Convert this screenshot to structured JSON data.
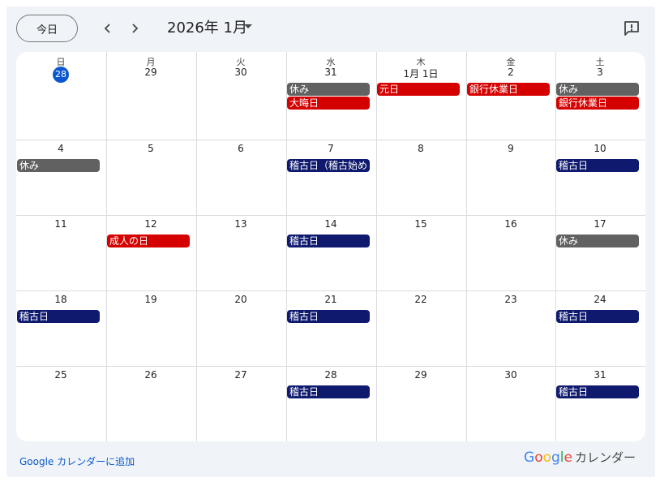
{
  "toolbar": {
    "today_label": "今日",
    "month_title": "2026年 1月",
    "prev_icon": "chevron-left-icon",
    "next_icon": "chevron-right-icon",
    "feedback_icon": "feedback-icon"
  },
  "weekdays": [
    "日",
    "月",
    "火",
    "水",
    "木",
    "金",
    "土"
  ],
  "weeks": [
    [
      {
        "date": "28",
        "today": true,
        "events": []
      },
      {
        "date": "29",
        "events": []
      },
      {
        "date": "30",
        "events": []
      },
      {
        "date": "31",
        "events": [
          {
            "title": "休み",
            "color": "#616161"
          },
          {
            "title": "大晦日",
            "color": "#d50000"
          }
        ]
      },
      {
        "date": "1月 1日",
        "events": [
          {
            "title": "元日",
            "color": "#d50000"
          }
        ]
      },
      {
        "date": "2",
        "events": [
          {
            "title": "銀行休業日",
            "color": "#d50000"
          }
        ]
      },
      {
        "date": "3",
        "events": [
          {
            "title": "休み",
            "color": "#616161"
          },
          {
            "title": "銀行休業日",
            "color": "#d50000"
          }
        ]
      }
    ],
    [
      {
        "date": "4",
        "events": [
          {
            "title": "休み",
            "color": "#616161"
          }
        ]
      },
      {
        "date": "5",
        "events": []
      },
      {
        "date": "6",
        "events": []
      },
      {
        "date": "7",
        "events": [
          {
            "title": "稽古日（稽古始め",
            "color": "#0f1a6e"
          }
        ]
      },
      {
        "date": "8",
        "events": []
      },
      {
        "date": "9",
        "events": []
      },
      {
        "date": "10",
        "events": [
          {
            "title": "稽古日",
            "color": "#0f1a6e"
          }
        ]
      }
    ],
    [
      {
        "date": "11",
        "events": []
      },
      {
        "date": "12",
        "events": [
          {
            "title": "成人の日",
            "color": "#d50000"
          }
        ]
      },
      {
        "date": "13",
        "events": []
      },
      {
        "date": "14",
        "events": [
          {
            "title": "稽古日",
            "color": "#0f1a6e"
          }
        ]
      },
      {
        "date": "15",
        "events": []
      },
      {
        "date": "16",
        "events": []
      },
      {
        "date": "17",
        "events": [
          {
            "title": "休み",
            "color": "#616161"
          }
        ]
      }
    ],
    [
      {
        "date": "18",
        "events": [
          {
            "title": "稽古日",
            "color": "#0f1a6e"
          }
        ]
      },
      {
        "date": "19",
        "events": []
      },
      {
        "date": "20",
        "events": []
      },
      {
        "date": "21",
        "events": [
          {
            "title": "稽古日",
            "color": "#0f1a6e"
          }
        ]
      },
      {
        "date": "22",
        "events": []
      },
      {
        "date": "23",
        "events": []
      },
      {
        "date": "24",
        "events": [
          {
            "title": "稽古日",
            "color": "#0f1a6e"
          }
        ]
      }
    ],
    [
      {
        "date": "25",
        "events": []
      },
      {
        "date": "26",
        "events": []
      },
      {
        "date": "27",
        "events": []
      },
      {
        "date": "28",
        "events": [
          {
            "title": "稽古日",
            "color": "#0f1a6e"
          }
        ]
      },
      {
        "date": "29",
        "events": []
      },
      {
        "date": "30",
        "events": []
      },
      {
        "date": "31",
        "events": [
          {
            "title": "稽古日",
            "color": "#0f1a6e"
          }
        ]
      }
    ]
  ],
  "footer": {
    "add_link": "Google カレンダーに追加",
    "brand_google": [
      "G",
      "o",
      "o",
      "g",
      "l",
      "e"
    ],
    "brand_calendar": "カレンダー"
  }
}
